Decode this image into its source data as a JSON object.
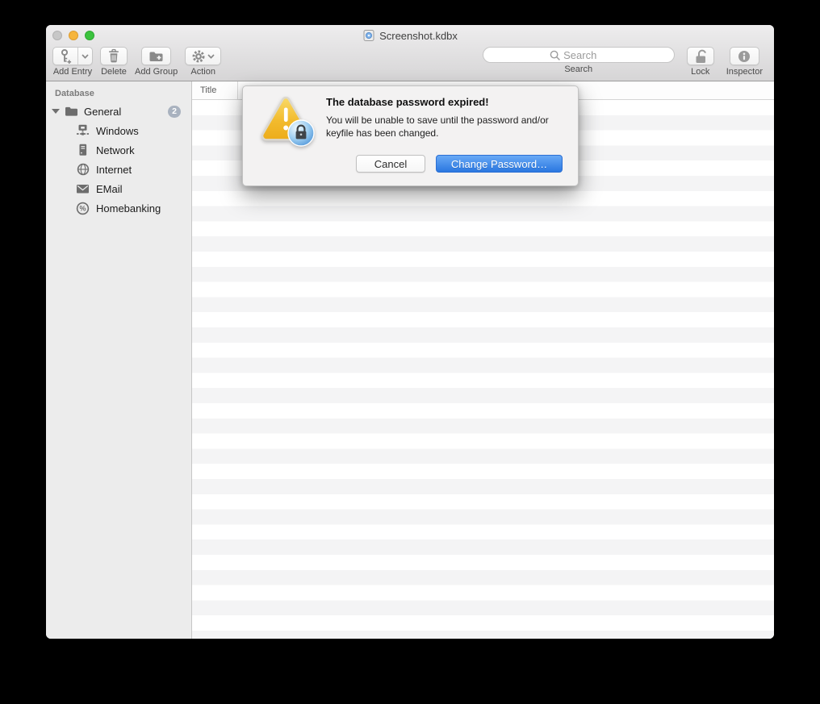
{
  "window": {
    "title": "Screenshot.kdbx"
  },
  "toolbar": {
    "add_entry": {
      "label": "Add Entry",
      "icon": "key-plus-icon"
    },
    "delete": {
      "label": "Delete",
      "icon": "trash-icon"
    },
    "add_group": {
      "label": "Add Group",
      "icon": "folder-plus-icon"
    },
    "action": {
      "label": "Action",
      "icon": "gear-icon"
    },
    "search": {
      "label": "Search",
      "placeholder": "Search",
      "icon": "magnifier-icon"
    },
    "lock": {
      "label": "Lock",
      "icon": "open-padlock-icon"
    },
    "inspector": {
      "label": "Inspector",
      "icon": "info-icon"
    }
  },
  "sidebar": {
    "header": "Database",
    "group": {
      "label": "General",
      "badge": "2",
      "icon": "folder-icon",
      "expanded": true
    },
    "items": [
      {
        "label": "Windows",
        "icon": "workgroup-icon"
      },
      {
        "label": "Network",
        "icon": "server-icon"
      },
      {
        "label": "Internet",
        "icon": "globe-icon"
      },
      {
        "label": "EMail",
        "icon": "envelope-icon"
      },
      {
        "label": "Homebanking",
        "icon": "percent-icon"
      }
    ]
  },
  "table": {
    "columns": [
      {
        "label": "Title"
      }
    ],
    "rows": []
  },
  "dialog": {
    "title": "The database password expired!",
    "message": "You will be unable to save until the password and/or keyfile has been changed.",
    "cancel_label": "Cancel",
    "confirm_label": "Change Password…",
    "icon": "warning-triangle-lock-icon"
  },
  "colors": {
    "accent_blue": "#2f7ce2",
    "warning_yellow": "#f2bb2e",
    "badge_gray": "#a9b2bf",
    "traffic_close_disabled": "#c7c7c7",
    "traffic_minimize": "#f6b53d",
    "traffic_zoom": "#3cc33e"
  }
}
